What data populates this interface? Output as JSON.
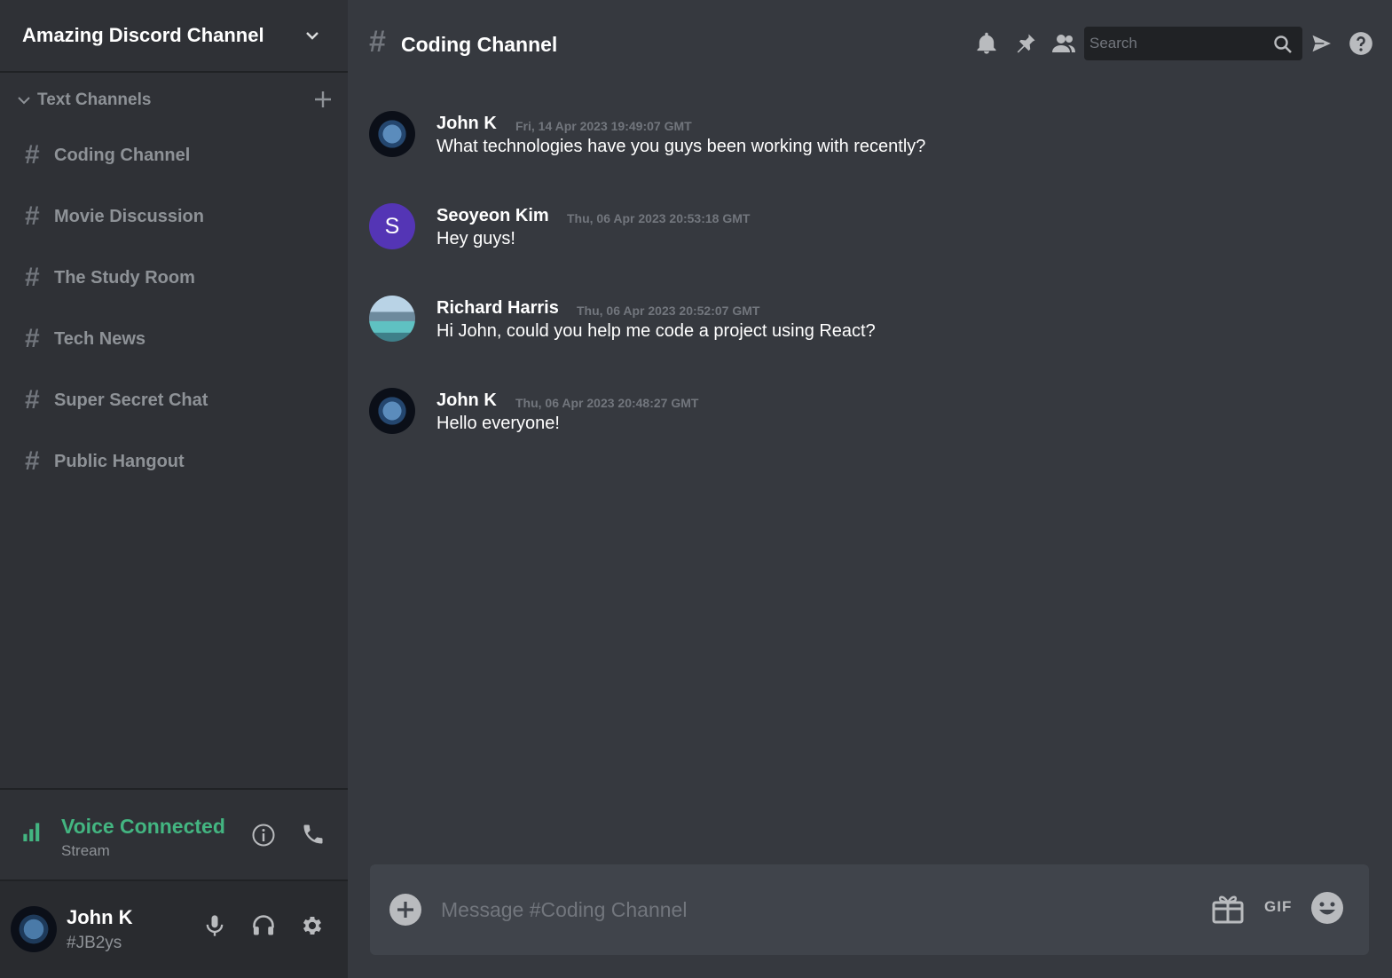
{
  "server": {
    "name": "Amazing Discord Channel",
    "chevron_icon": "chevron-down-icon"
  },
  "category": {
    "label": "Text Channels",
    "chevron_icon": "chevron-down-icon",
    "add_icon": "plus-icon"
  },
  "channels": [
    {
      "label": "Coding Channel"
    },
    {
      "label": "Movie Discussion"
    },
    {
      "label": "The Study Room"
    },
    {
      "label": "Tech News"
    },
    {
      "label": "Super Secret Chat"
    },
    {
      "label": "Public Hangout"
    }
  ],
  "channel_hash": "#",
  "voice": {
    "title": "Voice Connected",
    "subtitle": "Stream",
    "color": "#43b581"
  },
  "user": {
    "name": "John K",
    "tag": "#JB2ys"
  },
  "header": {
    "hash": "#",
    "title": "Coding Channel",
    "search_placeholder": "Search"
  },
  "messages": [
    {
      "author": "John K",
      "time": "Fri, 14 Apr 2023 19:49:07 GMT",
      "text": "What technologies have you guys been working with recently?",
      "avatar": "earth-avatar"
    },
    {
      "author": "Seoyeon Kim",
      "time": "Thu, 06 Apr 2023 20:53:18 GMT",
      "text": "Hey guys!",
      "avatar": "S"
    },
    {
      "author": "Richard Harris",
      "time": "Thu, 06 Apr 2023 20:52:07 GMT",
      "text": "Hi John, could you help me code a project using React?",
      "avatar": "photo-avatar"
    },
    {
      "author": "John K",
      "time": "Thu, 06 Apr 2023 20:48:27 GMT",
      "text": "Hello everyone!",
      "avatar": "earth-avatar"
    }
  ],
  "composer": {
    "placeholder": "Message #Coding Channel",
    "gif_label": "GIF"
  },
  "colors": {
    "sidebar": "#2f3136",
    "main": "#36393f",
    "user_panel": "#292b2f",
    "input": "#40444b",
    "accent_purple": "#5435b5"
  }
}
